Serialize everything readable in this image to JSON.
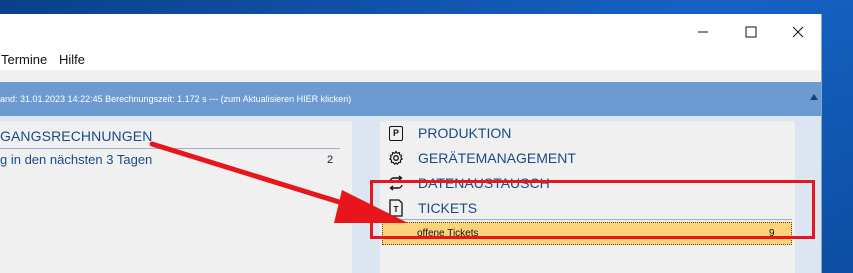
{
  "window": {
    "menu": [
      "Termine",
      "Hilfe"
    ],
    "controls": {
      "minimize_icon": "minimize-icon",
      "maximize_icon": "maximize-icon",
      "close_icon": "close-icon"
    }
  },
  "status": {
    "text": "and: 31.01.2023 14:22:45 Berechnungszeit: 1.172 s --- (zum Aktualisieren HIER klicken)"
  },
  "left_panel": {
    "heading": "GANGSRECHNUNGEN",
    "row_label": "g in den nächsten 3 Tagen",
    "row_count": "2"
  },
  "right_panel": {
    "categories": [
      {
        "label": "PRODUKTION",
        "icon": "p-box-icon",
        "icon_glyph": "P"
      },
      {
        "label": "GERÄTEMANAGEMENT",
        "icon": "gear-icon",
        "icon_glyph": "⚙"
      },
      {
        "label": "DATENAUSTAUSCH",
        "icon": "sync-arrows-icon",
        "icon_glyph": "⇄"
      },
      {
        "label": "TICKETS",
        "icon": "ticket-icon",
        "icon_glyph": "T"
      }
    ],
    "ticket_row": {
      "label": "offene Tickets",
      "count": "9"
    }
  },
  "colors": {
    "accent_blue": "#6b9bd0",
    "label_blue": "#1a4a86",
    "highlight": "#fcd27a",
    "annotation_red": "#e8151c"
  }
}
